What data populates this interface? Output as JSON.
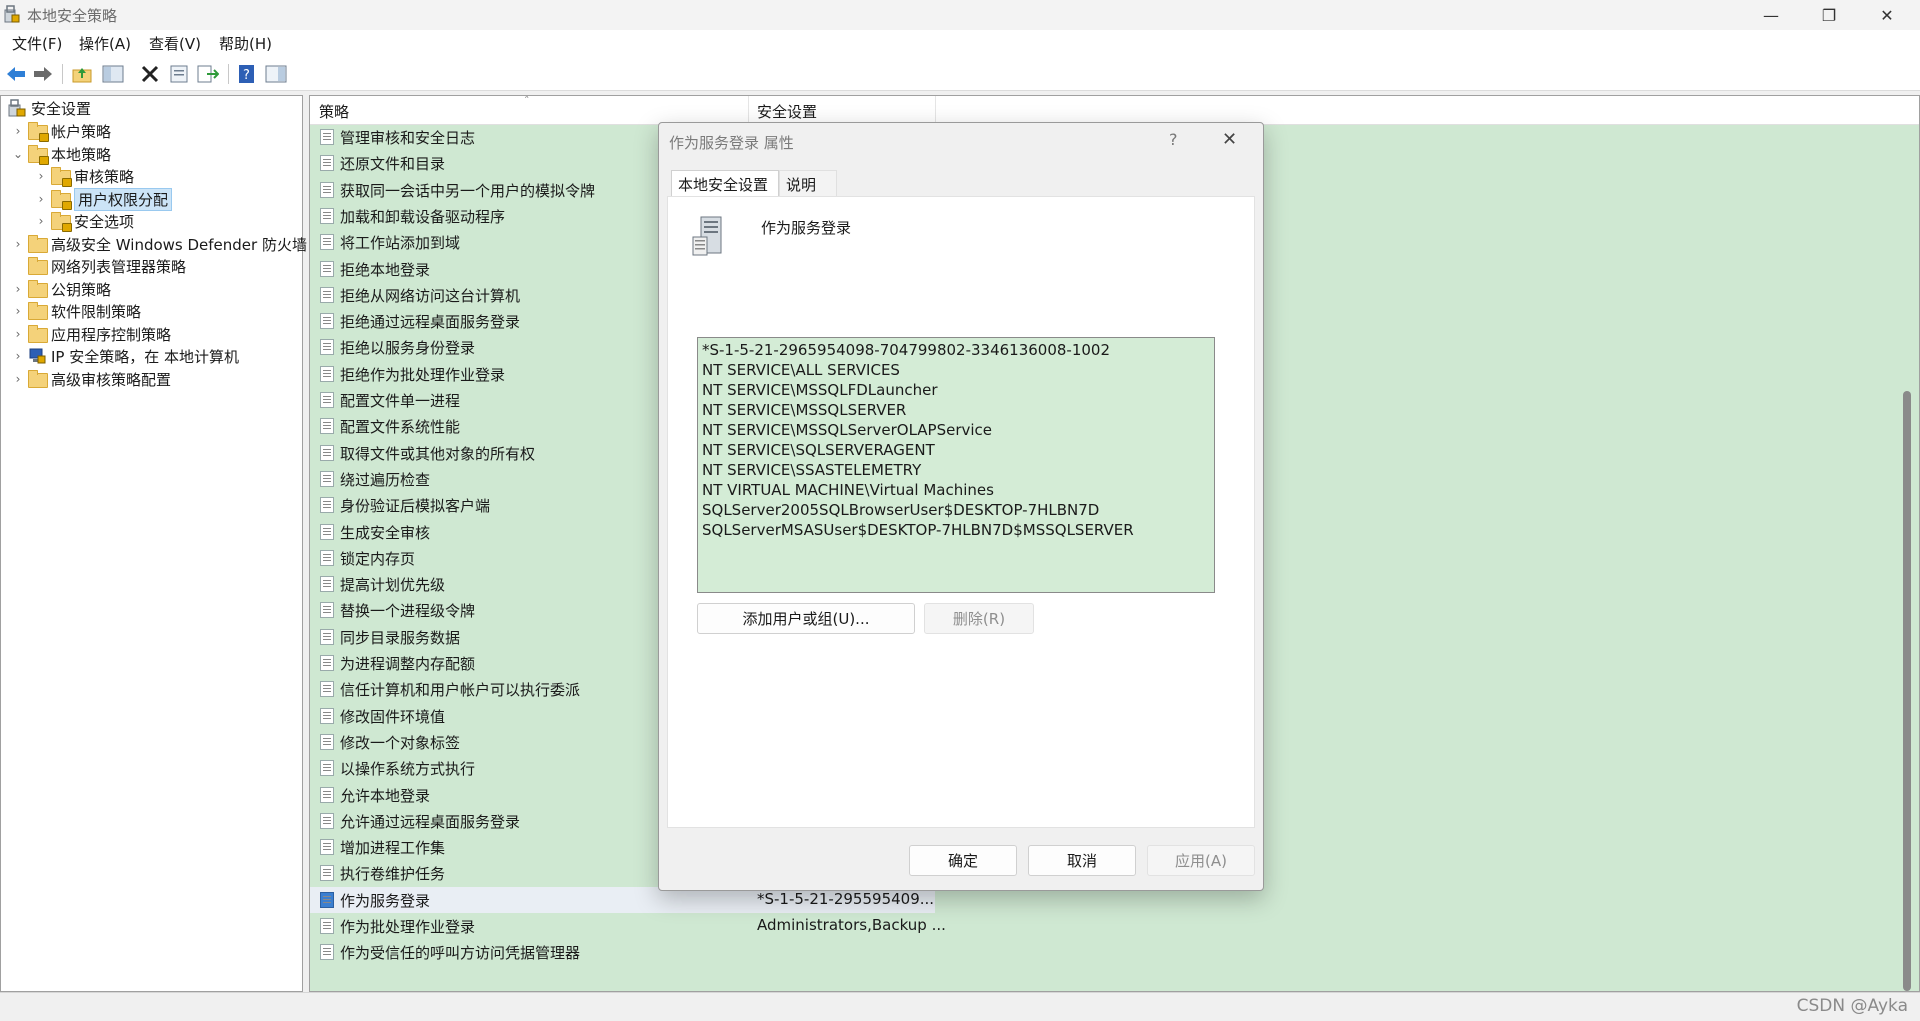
{
  "window": {
    "title": "本地安全策略",
    "controls": {
      "minimize": "—",
      "maximize": "❐",
      "close": "✕"
    }
  },
  "menubar": [
    {
      "label": "文件(F)"
    },
    {
      "label": "操作(A)"
    },
    {
      "label": "查看(V)"
    },
    {
      "label": "帮助(H)"
    }
  ],
  "toolbar": {
    "icons": [
      "back-arrow-icon",
      "forward-arrow-icon",
      "up-folder-icon",
      "show-hide-tree-icon",
      "delete-icon",
      "properties-icon",
      "export-list-icon",
      "help-icon",
      "show-action-pane-icon"
    ]
  },
  "tree": {
    "items": [
      {
        "label": "安全设置",
        "chevron": "",
        "icon": "security-settings-icon"
      },
      {
        "label": "帐户策略",
        "chevron": "›",
        "icon": "folder-lock-icon"
      },
      {
        "label": "本地策略",
        "chevron": "⌄",
        "icon": "folder-lock-icon"
      },
      {
        "label": "审核策略",
        "chevron": "›",
        "icon": "folder-lock-icon"
      },
      {
        "label": "用户权限分配",
        "chevron": "›",
        "icon": "folder-lock-icon"
      },
      {
        "label": "安全选项",
        "chevron": "›",
        "icon": "folder-lock-icon"
      },
      {
        "label": "高级安全 Windows Defender 防火墙",
        "chevron": "›",
        "icon": "folder-icon"
      },
      {
        "label": "网络列表管理器策略",
        "chevron": "",
        "icon": "folder-icon"
      },
      {
        "label": "公钥策略",
        "chevron": "›",
        "icon": "folder-icon"
      },
      {
        "label": "软件限制策略",
        "chevron": "›",
        "icon": "folder-icon"
      },
      {
        "label": "应用程序控制策略",
        "chevron": "›",
        "icon": "folder-icon"
      },
      {
        "label": "IP 安全策略，在 本地计算机",
        "chevron": "›",
        "icon": "ip-security-icon"
      },
      {
        "label": "高级审核策略配置",
        "chevron": "›",
        "icon": "folder-icon"
      }
    ]
  },
  "list": {
    "columns": {
      "policy": "策略",
      "setting": "安全设置",
      "sort_indicator": "˄"
    },
    "rows": [
      {
        "name": "管理审核和安全日志",
        "value": ""
      },
      {
        "name": "还原文件和目录",
        "value": ""
      },
      {
        "name": "获取同一会话中另一个用户的模拟令牌",
        "value": ""
      },
      {
        "name": "加载和卸载设备驱动程序",
        "value": ""
      },
      {
        "name": "将工作站添加到域",
        "value": ""
      },
      {
        "name": "拒绝本地登录",
        "value": ""
      },
      {
        "name": "拒绝从网络访问这台计算机",
        "value": ""
      },
      {
        "name": "拒绝通过远程桌面服务登录",
        "value": ""
      },
      {
        "name": "拒绝以服务身份登录",
        "value": ""
      },
      {
        "name": "拒绝作为批处理作业登录",
        "value": ""
      },
      {
        "name": "配置文件单一进程",
        "value": ""
      },
      {
        "name": "配置文件系统性能",
        "value": ""
      },
      {
        "name": "取得文件或其他对象的所有权",
        "value": ""
      },
      {
        "name": "绕过遍历检查",
        "value": ""
      },
      {
        "name": "身份验证后模拟客户端",
        "value": ""
      },
      {
        "name": "生成安全审核",
        "value": ""
      },
      {
        "name": "锁定内存页",
        "value": ""
      },
      {
        "name": "提高计划优先级",
        "value": ""
      },
      {
        "name": "替换一个进程级令牌",
        "value": ""
      },
      {
        "name": "同步目录服务数据",
        "value": ""
      },
      {
        "name": "为进程调整内存配额",
        "value": ""
      },
      {
        "name": "信任计算机和用户帐户可以执行委派",
        "value": ""
      },
      {
        "name": "修改固件环境值",
        "value": ""
      },
      {
        "name": "修改一个对象标签",
        "value": ""
      },
      {
        "name": "以操作系统方式执行",
        "value": ""
      },
      {
        "name": "允许本地登录",
        "value": ""
      },
      {
        "name": "允许通过远程桌面服务登录",
        "value": ""
      },
      {
        "name": "增加进程工作集",
        "value": ""
      },
      {
        "name": "执行卷维护任务",
        "value": ""
      },
      {
        "name": "作为服务登录",
        "value": "*S-1-5-21-295595409..."
      },
      {
        "name": "作为批处理作业登录",
        "value": "Administrators,Backup ..."
      },
      {
        "name": "作为受信任的呼叫方访问凭据管理器",
        "value": ""
      }
    ]
  },
  "dialog": {
    "title": "作为服务登录 属性",
    "help": "?",
    "close": "✕",
    "tabs": [
      {
        "label": "本地安全设置"
      },
      {
        "label": "说明"
      }
    ],
    "policy_name": "作为服务登录",
    "members": [
      "*S-1-5-21-2965954098-704799802-3346136008-1002",
      "NT SERVICE\\ALL SERVICES",
      "NT SERVICE\\MSSQLFDLauncher",
      "NT SERVICE\\MSSQLSERVER",
      "NT SERVICE\\MSSQLServerOLAPService",
      "NT SERVICE\\SQLSERVERAGENT",
      "NT SERVICE\\SSASTELEMETRY",
      "NT VIRTUAL MACHINE\\Virtual Machines",
      "SQLServer2005SQLBrowserUser$DESKTOP-7HLBN7D",
      "SQLServerMSASUser$DESKTOP-7HLBN7D$MSSQLSERVER"
    ],
    "add_button": "添加用户或组(U)...",
    "remove_button": "删除(R)",
    "ok_button": "确定",
    "cancel_button": "取消",
    "apply_button": "应用(A)"
  },
  "statusbar": {
    "watermark": "CSDN @Ayka"
  },
  "colors": {
    "list_bg": "#cfe8d2",
    "members_bg": "#d4ecd6",
    "selected_tree": "#cce4f7"
  }
}
